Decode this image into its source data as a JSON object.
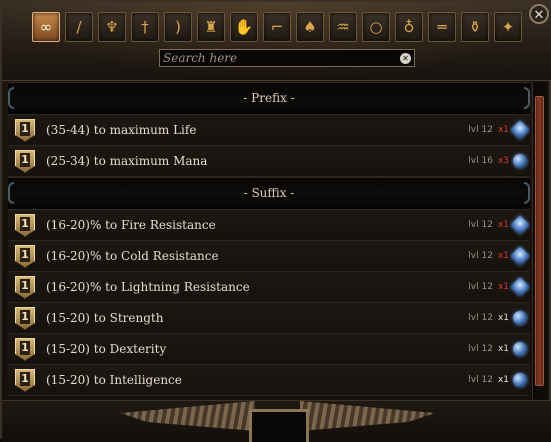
{
  "window": {
    "close_glyph": "✕"
  },
  "categories": [
    {
      "icon": "all-icon",
      "glyph": "∞",
      "active": true
    },
    {
      "icon": "staff-icon",
      "glyph": "/",
      "active": false
    },
    {
      "icon": "axe-icon",
      "glyph": "♆",
      "active": false
    },
    {
      "icon": "sword-icon",
      "glyph": "†",
      "active": false
    },
    {
      "icon": "bow-icon",
      "glyph": ")",
      "active": false
    },
    {
      "icon": "helmet-icon",
      "glyph": "♜",
      "active": false
    },
    {
      "icon": "glove-icon",
      "glyph": "✋",
      "active": false
    },
    {
      "icon": "boots-icon",
      "glyph": "⌐",
      "active": false
    },
    {
      "icon": "armor-icon",
      "glyph": "♠",
      "active": false
    },
    {
      "icon": "quiver-icon",
      "glyph": "♒",
      "active": false
    },
    {
      "icon": "ring-icon",
      "glyph": "○",
      "active": false
    },
    {
      "icon": "amulet-icon",
      "glyph": "♁",
      "active": false
    },
    {
      "icon": "belt-icon",
      "glyph": "═",
      "active": false
    },
    {
      "icon": "flask-icon",
      "glyph": "⚱",
      "active": false
    },
    {
      "icon": "jewel-icon",
      "glyph": "✦",
      "active": false
    }
  ],
  "search": {
    "placeholder": "Search here",
    "value": "",
    "clear_glyph": "✕"
  },
  "sections": [
    {
      "title": "- Prefix -",
      "mods": [
        {
          "tier": "1",
          "text": "(35-44) to maximum Life",
          "level": "lvl 12",
          "mult": "x1",
          "mult_color": "red",
          "orb": "spiky"
        },
        {
          "tier": "1",
          "text": "(25-34) to maximum Mana",
          "level": "lvl 16",
          "mult": "x3",
          "mult_color": "red",
          "orb": "round"
        }
      ]
    },
    {
      "title": "- Suffix -",
      "mods": [
        {
          "tier": "1",
          "text": "(16-20)% to Fire Resistance",
          "level": "lvl 12",
          "mult": "x1",
          "mult_color": "red",
          "orb": "spiky"
        },
        {
          "tier": "1",
          "text": "(16-20)% to Cold Resistance",
          "level": "lvl 12",
          "mult": "x1",
          "mult_color": "red",
          "orb": "spiky"
        },
        {
          "tier": "1",
          "text": "(16-20)% to Lightning Resistance",
          "level": "lvl 12",
          "mult": "x1",
          "mult_color": "red",
          "orb": "spiky"
        },
        {
          "tier": "1",
          "text": "(15-20) to Strength",
          "level": "lvl 12",
          "mult": "x1",
          "mult_color": "white",
          "orb": "round"
        },
        {
          "tier": "1",
          "text": "(15-20) to Dexterity",
          "level": "lvl 12",
          "mult": "x1",
          "mult_color": "white",
          "orb": "round"
        },
        {
          "tier": "1",
          "text": "(15-20) to Intelligence",
          "level": "lvl 12",
          "mult": "x1",
          "mult_color": "white",
          "orb": "round"
        }
      ]
    }
  ]
}
